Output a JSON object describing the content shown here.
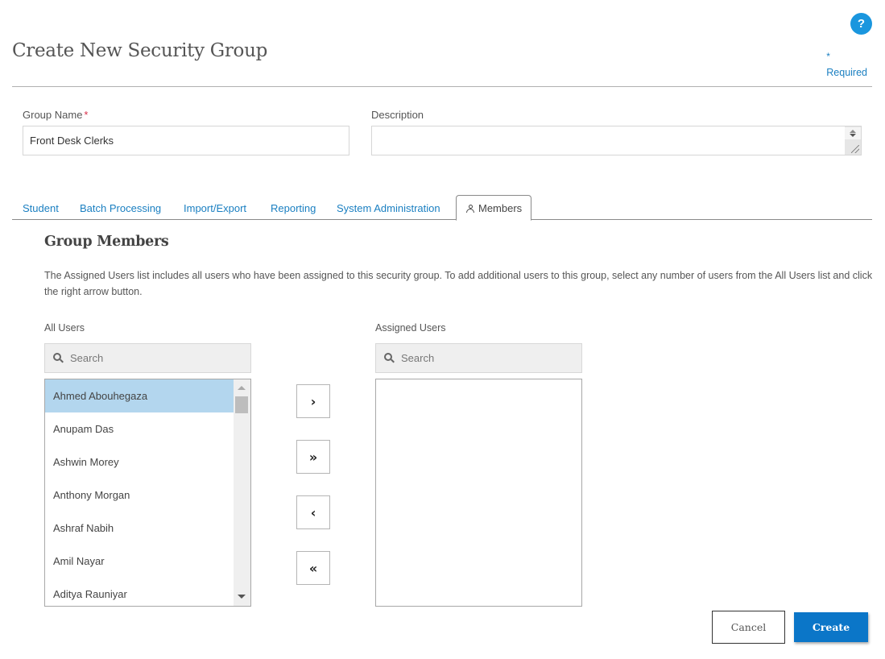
{
  "header": {
    "title": "Create New Security Group",
    "help_label": "?",
    "required_star": "*",
    "required_label": "Required"
  },
  "form": {
    "group_name_label": "Group Name",
    "group_name_required_star": "*",
    "group_name_value": "Front Desk Clerks",
    "description_label": "Description",
    "description_value": ""
  },
  "tabs": [
    {
      "label": "Student",
      "active": false
    },
    {
      "label": "Batch Processing",
      "active": false
    },
    {
      "label": "Import/Export",
      "active": false
    },
    {
      "label": "Reporting",
      "active": false
    },
    {
      "label": "System Administration",
      "active": false
    },
    {
      "label": "Members",
      "active": true,
      "icon": "person-icon"
    }
  ],
  "members": {
    "title": "Group Members",
    "description": "The Assigned Users list includes all users who have been assigned to this security group. To add additional users to this group, select any number of users from the All Users list and click the right arrow button.",
    "all_users_label": "All Users",
    "all_users_search_placeholder": "Search",
    "all_users": [
      {
        "name": "Ahmed Abouhegaza",
        "selected": true
      },
      {
        "name": "Anupam Das",
        "selected": false
      },
      {
        "name": "Ashwin Morey",
        "selected": false
      },
      {
        "name": "Anthony Morgan",
        "selected": false
      },
      {
        "name": "Ashraf Nabih",
        "selected": false
      },
      {
        "name": "Amil Nayar",
        "selected": false
      },
      {
        "name": "Aditya Rauniyar",
        "selected": false
      }
    ],
    "assigned_users_label": "Assigned Users",
    "assigned_users_search_placeholder": "Search",
    "assigned_users": [],
    "move_buttons": {
      "add_selected": "›",
      "add_all": "»",
      "remove_selected": "‹",
      "remove_all": "«"
    }
  },
  "actions": {
    "cancel_label": "Cancel",
    "create_label": "Create"
  },
  "colors": {
    "accent": "#1a7fc1",
    "primary_button": "#0b76c8",
    "selected_row": "#b3d6ee",
    "required_star": "#d9304a",
    "help_icon": "#1a96de"
  }
}
